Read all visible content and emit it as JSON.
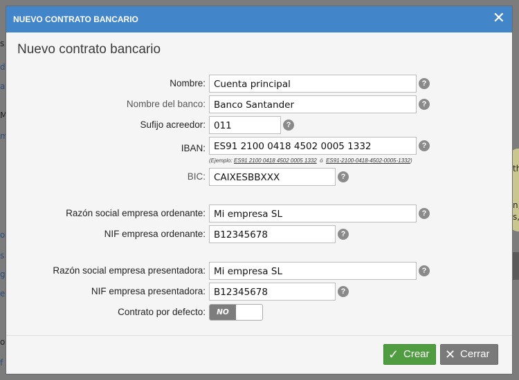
{
  "background_fragments": {
    "a": "s",
    "b": "d",
    "c": "a",
    "d": "M",
    "e": "m",
    "f": "o",
    "g": "s",
    "h": "g",
    "i": "e",
    "j": "o",
    "k": "f",
    "r1": "th",
    "r2": "n,",
    "r3": "s,",
    "r4": "r"
  },
  "dialog": {
    "title": "NUEVO CONTRATO BANCARIO",
    "close_icon": "close-icon",
    "heading": "Nuevo contrato bancario"
  },
  "form": {
    "nombre": {
      "label": "Nombre:",
      "value": "Cuenta principal"
    },
    "banco": {
      "label": "Nombre del banco:",
      "value": "Banco Santander"
    },
    "sufijo": {
      "label": "Sufijo acreedor:",
      "value": "011"
    },
    "iban": {
      "label": "IBAN:",
      "value": "ES91 2100 0418 4502 0005 1332"
    },
    "iban_hint": {
      "prefix": "(Ejemplo:",
      "example1": "ES91 2100 0418 4502 0005 1332",
      "sep": "ó",
      "example2": "ES91-2100-0418-4502-0005-1332",
      "suffix": ")"
    },
    "bic": {
      "label": "BIC:",
      "value": "CAIXESBBXXX"
    },
    "razon_ordenante": {
      "label": "Razón social empresa ordenante:",
      "value": "Mi empresa SL"
    },
    "nif_ordenante": {
      "label": "NIF empresa ordenante:",
      "value": "B12345678"
    },
    "razon_presentadora": {
      "label": "Razón social empresa presentadora:",
      "value": "Mi empresa SL"
    },
    "nif_presentadora": {
      "label": "NIF empresa presentadora:",
      "value": "B12345678"
    },
    "defecto": {
      "label": "Contrato por defecto:",
      "toggle_text": "NO"
    },
    "help_glyph": "?"
  },
  "buttons": {
    "create": {
      "label": "Crear",
      "icon": "check-icon",
      "glyph": "✓"
    },
    "close": {
      "label": "Cerrar",
      "icon": "x-icon",
      "glyph": "✕"
    }
  },
  "colors": {
    "titlebar": "#4285c8",
    "create": "#4f9d40",
    "close": "#7a7a7a"
  }
}
